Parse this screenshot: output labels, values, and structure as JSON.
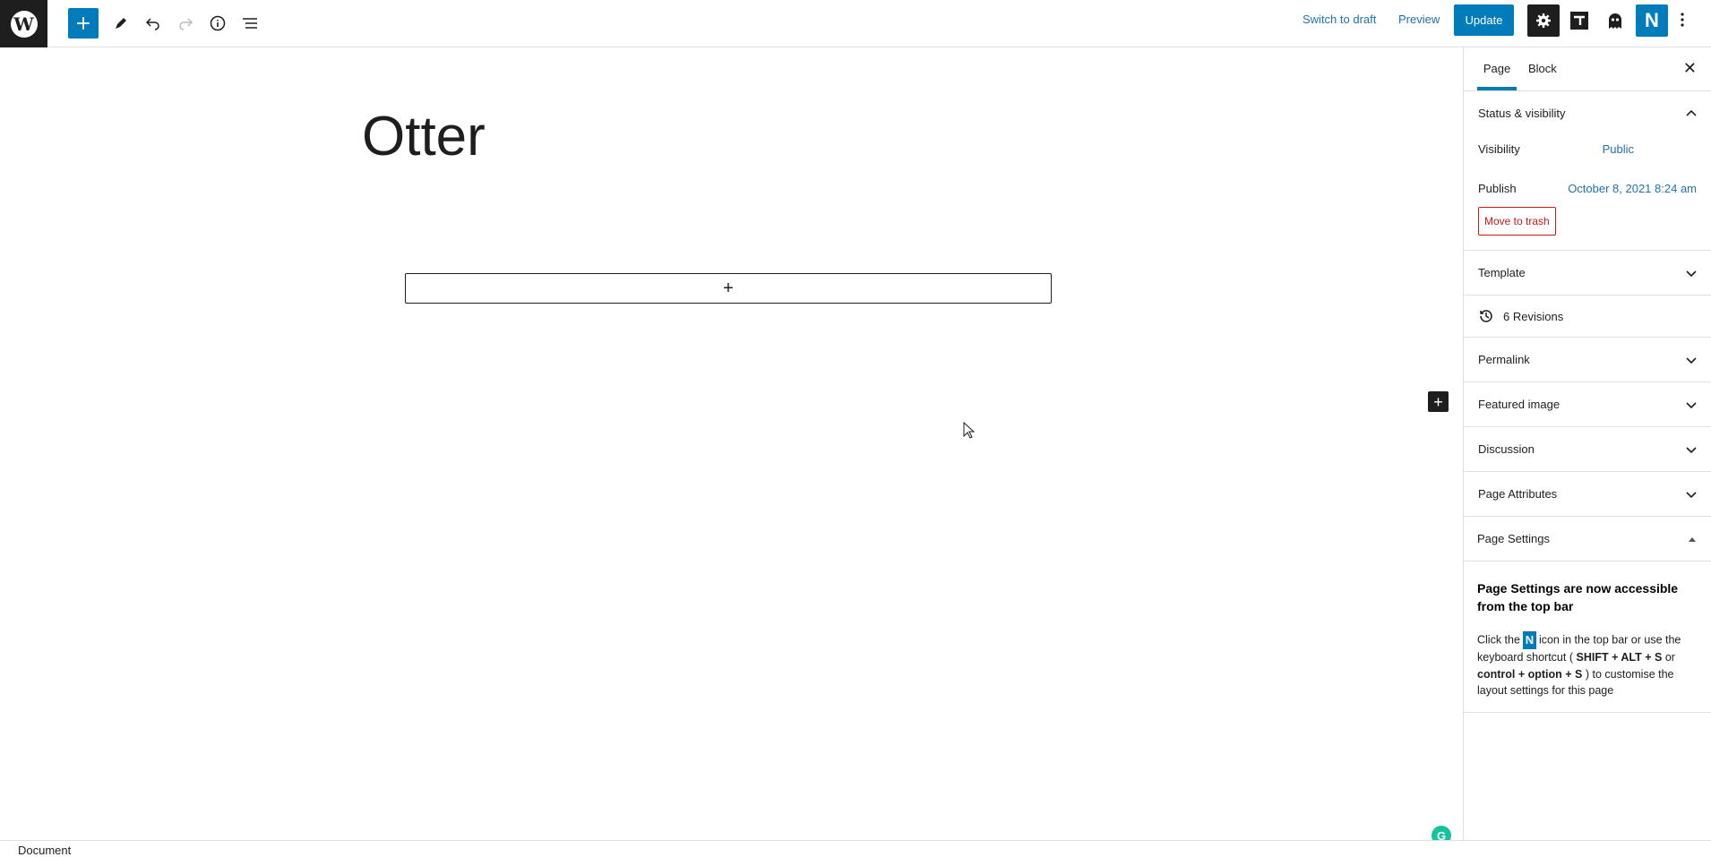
{
  "topbar": {
    "switch_to_draft": "Switch to draft",
    "preview": "Preview",
    "update": "Update",
    "neve_badge": "N"
  },
  "editor": {
    "title": "Otter",
    "appender_symbol": "+",
    "side_inserter_symbol": "+"
  },
  "sidebar": {
    "tabs": [
      "Page",
      "Block"
    ],
    "close_symbol": "✕",
    "status_visibility": {
      "heading": "Status & visibility",
      "visibility_label": "Visibility",
      "visibility_value": "Public",
      "publish_label": "Publish",
      "publish_value": "October 8, 2021 8:24 am",
      "trash_label": "Move to trash"
    },
    "template": "Template",
    "revisions": "6 Revisions",
    "permalink": "Permalink",
    "featured_image": "Featured image",
    "discussion": "Discussion",
    "page_attributes": "Page Attributes",
    "page_settings": {
      "heading": "Page Settings",
      "title": "Page Settings are now accessible from the top bar",
      "text_click": "Click the",
      "badge": "N",
      "text_rest": "icon in the top bar or use the keyboard shortcut (",
      "shortcut_1": "SHIFT + ALT + S",
      "text_or": "or",
      "shortcut_2": "control + option + S",
      "text_end": ") to customise the layout settings for this page"
    }
  },
  "footer": {
    "breadcrumb": "Document"
  },
  "grammarly_badge": "G",
  "colors": {
    "accent": "#007cba",
    "dark": "#1e1e1e",
    "danger": "#cc1818",
    "link": "#2271b1"
  }
}
